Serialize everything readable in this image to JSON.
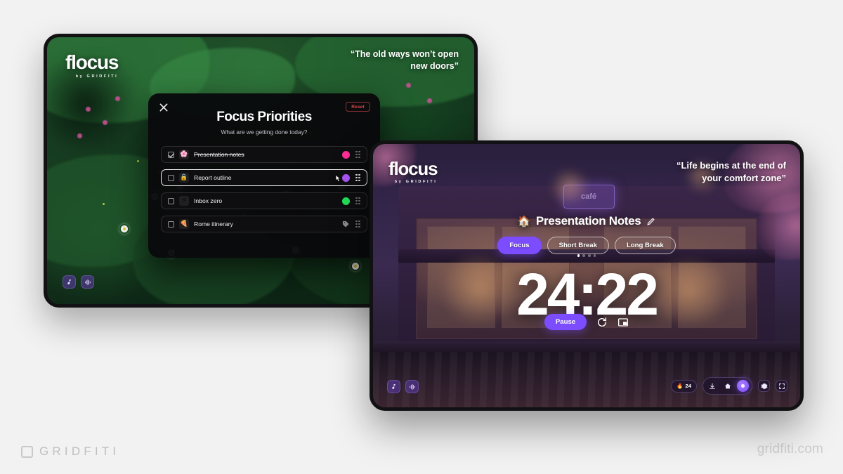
{
  "branding": {
    "footer_left_word": "GRIDFITI",
    "footer_left_mark": "gridfiti-logo-mark",
    "footer_right": "gridfiti.com"
  },
  "left_screen": {
    "logo": {
      "name": "flocus",
      "sub": "by GRIDFITI"
    },
    "quote": "“The old ways won’t open new doors”",
    "media_buttons": [
      {
        "name": "music-note-icon",
        "label": "Music"
      },
      {
        "name": "soundscape-icon",
        "label": "Sounds"
      }
    ],
    "modal": {
      "close_label": "Close",
      "reset_label": "Reset",
      "title": "Focus Priorities",
      "subtitle": "What are we getting done today?",
      "tasks": [
        {
          "emoji": "🌸",
          "label": "Presentation notes",
          "checked": true,
          "done": true,
          "dot_color": "#ff2d96",
          "marker": "dot",
          "focused": false
        },
        {
          "emoji": "🔒",
          "label": "Report outline",
          "checked": false,
          "done": false,
          "dot_color": "#a855f7",
          "marker": "dot",
          "focused": true
        },
        {
          "emoji": "⚡",
          "label": "Inbox zero",
          "checked": false,
          "done": false,
          "dot_color": "#22e05a",
          "marker": "dot",
          "focused": false
        },
        {
          "emoji": "🍕",
          "label": "Rome itinerary",
          "checked": false,
          "done": false,
          "dot_color": "#8b8b92",
          "marker": "tag",
          "focused": false
        }
      ]
    }
  },
  "right_screen": {
    "logo": {
      "name": "flocus",
      "sub": "by GRIDFITI"
    },
    "quote": "“Life begins at the end of your comfort zone”",
    "cafe_sign_text": "café",
    "session_title": "Presentation Notes",
    "session_emoji": "🏠",
    "edit_icon": "pencil-icon",
    "modes": [
      {
        "label": "Focus",
        "active": true
      },
      {
        "label": "Short Break",
        "active": false
      },
      {
        "label": "Long Break",
        "active": false
      }
    ],
    "mode_dots": {
      "count": 4,
      "active_index": 0
    },
    "timer": "24:22",
    "controls": {
      "primary_label": "Pause",
      "reset_icon": "restart-icon",
      "pip_icon": "picture-in-picture-icon"
    },
    "media_buttons": [
      {
        "name": "music-note-icon",
        "label": "Music"
      },
      {
        "name": "soundscape-icon",
        "label": "Sounds"
      }
    ],
    "bottom_bar": {
      "streak_count": "24",
      "streak_icon": "flame-icon",
      "nav": [
        {
          "name": "download-icon",
          "active": false
        },
        {
          "name": "home-icon",
          "active": false
        },
        {
          "name": "theme-orb-icon",
          "active": true
        }
      ],
      "settings_icon": "gear-icon",
      "fullscreen_icon": "fullscreen-icon"
    }
  },
  "accent_colors": {
    "purple": "#7c4dff",
    "pink": "#ff2d96",
    "green": "#22e05a",
    "violet": "#a855f7",
    "red": "#e0484f"
  }
}
